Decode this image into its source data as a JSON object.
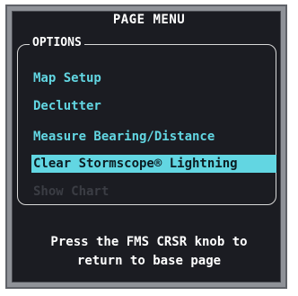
{
  "window": {
    "title": "PAGE MENU"
  },
  "options": {
    "label": "OPTIONS",
    "items": [
      {
        "label": "Map Setup",
        "state": "enabled"
      },
      {
        "label": "Declutter",
        "state": "enabled"
      },
      {
        "label": "Measure Bearing/Distance",
        "state": "enabled"
      },
      {
        "label": "Clear Stormscope® Lightning",
        "state": "selected"
      },
      {
        "label": "Show Chart",
        "state": "disabled"
      }
    ]
  },
  "help": {
    "line1": "Press the FMS CRSR knob to",
    "line2": "return to base page"
  },
  "colors": {
    "background": "#1b1c22",
    "bezel": "#8f9298",
    "item_text": "#62d6e2",
    "selected_bg": "#62d6e2",
    "disabled_text": "#3b3d44",
    "header_text": "#ffffff"
  }
}
